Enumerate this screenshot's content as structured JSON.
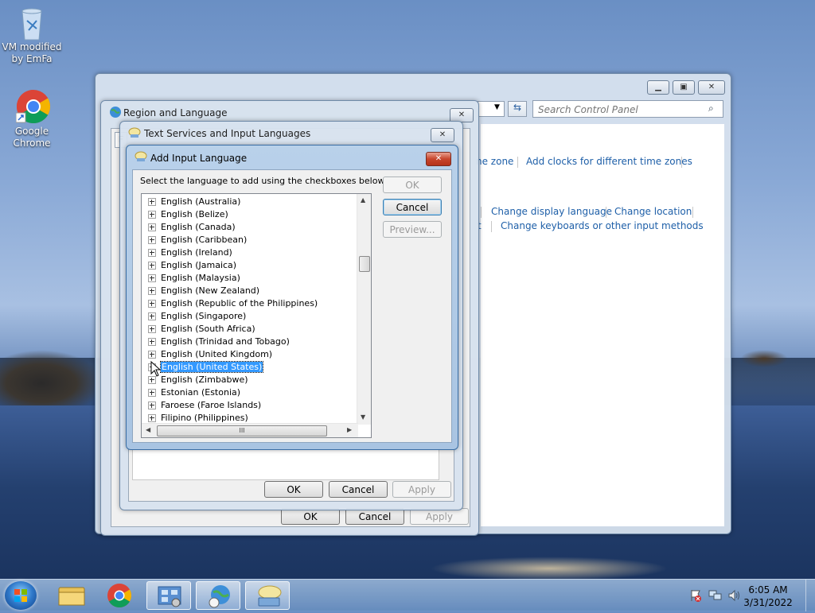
{
  "desktop": {
    "icons": [
      {
        "label_line1": "VM modified",
        "label_line2": "by EmFa"
      },
      {
        "label_line1": "Google",
        "label_line2": "Chrome"
      }
    ]
  },
  "control_panel": {
    "search_placeholder": "Search Control Panel",
    "links": {
      "time_zone_fragment": "ne zone",
      "add_clocks": "Add clocks for different time zones",
      "change_display_language": "Change display language",
      "change_location": "Change location",
      "t_fragment": "t",
      "change_keyboards": "Change keyboards or other input methods"
    }
  },
  "region_language": {
    "title": "Region and Language",
    "tab_fragment": "F",
    "ok": "OK",
    "cancel": "Cancel",
    "apply": "Apply"
  },
  "text_services": {
    "title": "Text Services and Input Languages",
    "ok": "OK",
    "cancel": "Cancel",
    "apply": "Apply"
  },
  "add_input_language": {
    "title": "Add Input Language",
    "instruction": "Select the language to add using the checkboxes below.",
    "ok": "OK",
    "cancel": "Cancel",
    "preview": "Preview...",
    "languages": [
      "English (Australia)",
      "English (Belize)",
      "English (Canada)",
      "English (Caribbean)",
      "English (Ireland)",
      "English (Jamaica)",
      "English (Malaysia)",
      "English (New Zealand)",
      "English (Republic of the Philippines)",
      "English (Singapore)",
      "English (South Africa)",
      "English (Trinidad and Tobago)",
      "English (United Kingdom)",
      "English (United States)",
      "English (Zimbabwe)",
      "Estonian (Estonia)",
      "Faroese (Faroe Islands)",
      "Filipino (Philippines)"
    ],
    "selected": "English (United States)",
    "hscroll_grip": "III"
  },
  "taskbar": {
    "time": "6:05 AM",
    "date": "3/31/2022"
  }
}
